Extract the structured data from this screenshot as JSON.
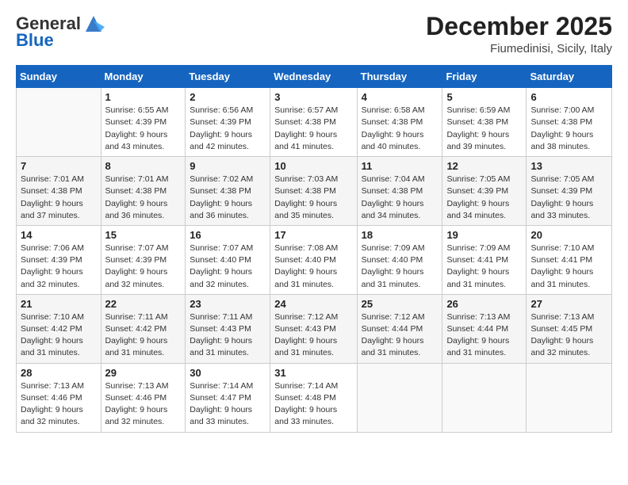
{
  "logo": {
    "general": "General",
    "blue": "Blue"
  },
  "header": {
    "month": "December 2025",
    "location": "Fiumedinisi, Sicily, Italy"
  },
  "weekdays": [
    "Sunday",
    "Monday",
    "Tuesday",
    "Wednesday",
    "Thursday",
    "Friday",
    "Saturday"
  ],
  "weeks": [
    [
      {
        "day": "",
        "info": ""
      },
      {
        "day": "1",
        "info": "Sunrise: 6:55 AM\nSunset: 4:39 PM\nDaylight: 9 hours\nand 43 minutes."
      },
      {
        "day": "2",
        "info": "Sunrise: 6:56 AM\nSunset: 4:39 PM\nDaylight: 9 hours\nand 42 minutes."
      },
      {
        "day": "3",
        "info": "Sunrise: 6:57 AM\nSunset: 4:38 PM\nDaylight: 9 hours\nand 41 minutes."
      },
      {
        "day": "4",
        "info": "Sunrise: 6:58 AM\nSunset: 4:38 PM\nDaylight: 9 hours\nand 40 minutes."
      },
      {
        "day": "5",
        "info": "Sunrise: 6:59 AM\nSunset: 4:38 PM\nDaylight: 9 hours\nand 39 minutes."
      },
      {
        "day": "6",
        "info": "Sunrise: 7:00 AM\nSunset: 4:38 PM\nDaylight: 9 hours\nand 38 minutes."
      }
    ],
    [
      {
        "day": "7",
        "info": "Sunrise: 7:01 AM\nSunset: 4:38 PM\nDaylight: 9 hours\nand 37 minutes."
      },
      {
        "day": "8",
        "info": "Sunrise: 7:01 AM\nSunset: 4:38 PM\nDaylight: 9 hours\nand 36 minutes."
      },
      {
        "day": "9",
        "info": "Sunrise: 7:02 AM\nSunset: 4:38 PM\nDaylight: 9 hours\nand 36 minutes."
      },
      {
        "day": "10",
        "info": "Sunrise: 7:03 AM\nSunset: 4:38 PM\nDaylight: 9 hours\nand 35 minutes."
      },
      {
        "day": "11",
        "info": "Sunrise: 7:04 AM\nSunset: 4:38 PM\nDaylight: 9 hours\nand 34 minutes."
      },
      {
        "day": "12",
        "info": "Sunrise: 7:05 AM\nSunset: 4:39 PM\nDaylight: 9 hours\nand 34 minutes."
      },
      {
        "day": "13",
        "info": "Sunrise: 7:05 AM\nSunset: 4:39 PM\nDaylight: 9 hours\nand 33 minutes."
      }
    ],
    [
      {
        "day": "14",
        "info": "Sunrise: 7:06 AM\nSunset: 4:39 PM\nDaylight: 9 hours\nand 32 minutes."
      },
      {
        "day": "15",
        "info": "Sunrise: 7:07 AM\nSunset: 4:39 PM\nDaylight: 9 hours\nand 32 minutes."
      },
      {
        "day": "16",
        "info": "Sunrise: 7:07 AM\nSunset: 4:40 PM\nDaylight: 9 hours\nand 32 minutes."
      },
      {
        "day": "17",
        "info": "Sunrise: 7:08 AM\nSunset: 4:40 PM\nDaylight: 9 hours\nand 31 minutes."
      },
      {
        "day": "18",
        "info": "Sunrise: 7:09 AM\nSunset: 4:40 PM\nDaylight: 9 hours\nand 31 minutes."
      },
      {
        "day": "19",
        "info": "Sunrise: 7:09 AM\nSunset: 4:41 PM\nDaylight: 9 hours\nand 31 minutes."
      },
      {
        "day": "20",
        "info": "Sunrise: 7:10 AM\nSunset: 4:41 PM\nDaylight: 9 hours\nand 31 minutes."
      }
    ],
    [
      {
        "day": "21",
        "info": "Sunrise: 7:10 AM\nSunset: 4:42 PM\nDaylight: 9 hours\nand 31 minutes."
      },
      {
        "day": "22",
        "info": "Sunrise: 7:11 AM\nSunset: 4:42 PM\nDaylight: 9 hours\nand 31 minutes."
      },
      {
        "day": "23",
        "info": "Sunrise: 7:11 AM\nSunset: 4:43 PM\nDaylight: 9 hours\nand 31 minutes."
      },
      {
        "day": "24",
        "info": "Sunrise: 7:12 AM\nSunset: 4:43 PM\nDaylight: 9 hours\nand 31 minutes."
      },
      {
        "day": "25",
        "info": "Sunrise: 7:12 AM\nSunset: 4:44 PM\nDaylight: 9 hours\nand 31 minutes."
      },
      {
        "day": "26",
        "info": "Sunrise: 7:13 AM\nSunset: 4:44 PM\nDaylight: 9 hours\nand 31 minutes."
      },
      {
        "day": "27",
        "info": "Sunrise: 7:13 AM\nSunset: 4:45 PM\nDaylight: 9 hours\nand 32 minutes."
      }
    ],
    [
      {
        "day": "28",
        "info": "Sunrise: 7:13 AM\nSunset: 4:46 PM\nDaylight: 9 hours\nand 32 minutes."
      },
      {
        "day": "29",
        "info": "Sunrise: 7:13 AM\nSunset: 4:46 PM\nDaylight: 9 hours\nand 32 minutes."
      },
      {
        "day": "30",
        "info": "Sunrise: 7:14 AM\nSunset: 4:47 PM\nDaylight: 9 hours\nand 33 minutes."
      },
      {
        "day": "31",
        "info": "Sunrise: 7:14 AM\nSunset: 4:48 PM\nDaylight: 9 hours\nand 33 minutes."
      },
      {
        "day": "",
        "info": ""
      },
      {
        "day": "",
        "info": ""
      },
      {
        "day": "",
        "info": ""
      }
    ]
  ]
}
